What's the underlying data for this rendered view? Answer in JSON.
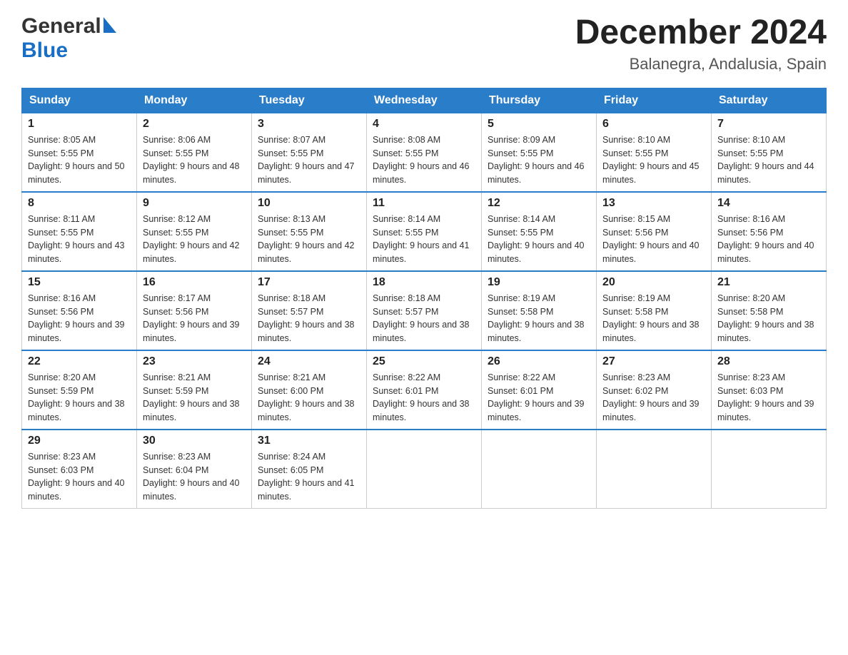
{
  "logo": {
    "general": "General",
    "blue": "Blue",
    "triangle": "▶"
  },
  "title": "December 2024",
  "subtitle": "Balanegra, Andalusia, Spain",
  "weekdays": [
    "Sunday",
    "Monday",
    "Tuesday",
    "Wednesday",
    "Thursday",
    "Friday",
    "Saturday"
  ],
  "weeks": [
    [
      {
        "day": "1",
        "sunrise": "8:05 AM",
        "sunset": "5:55 PM",
        "daylight": "9 hours and 50 minutes."
      },
      {
        "day": "2",
        "sunrise": "8:06 AM",
        "sunset": "5:55 PM",
        "daylight": "9 hours and 48 minutes."
      },
      {
        "day": "3",
        "sunrise": "8:07 AM",
        "sunset": "5:55 PM",
        "daylight": "9 hours and 47 minutes."
      },
      {
        "day": "4",
        "sunrise": "8:08 AM",
        "sunset": "5:55 PM",
        "daylight": "9 hours and 46 minutes."
      },
      {
        "day": "5",
        "sunrise": "8:09 AM",
        "sunset": "5:55 PM",
        "daylight": "9 hours and 46 minutes."
      },
      {
        "day": "6",
        "sunrise": "8:10 AM",
        "sunset": "5:55 PM",
        "daylight": "9 hours and 45 minutes."
      },
      {
        "day": "7",
        "sunrise": "8:10 AM",
        "sunset": "5:55 PM",
        "daylight": "9 hours and 44 minutes."
      }
    ],
    [
      {
        "day": "8",
        "sunrise": "8:11 AM",
        "sunset": "5:55 PM",
        "daylight": "9 hours and 43 minutes."
      },
      {
        "day": "9",
        "sunrise": "8:12 AM",
        "sunset": "5:55 PM",
        "daylight": "9 hours and 42 minutes."
      },
      {
        "day": "10",
        "sunrise": "8:13 AM",
        "sunset": "5:55 PM",
        "daylight": "9 hours and 42 minutes."
      },
      {
        "day": "11",
        "sunrise": "8:14 AM",
        "sunset": "5:55 PM",
        "daylight": "9 hours and 41 minutes."
      },
      {
        "day": "12",
        "sunrise": "8:14 AM",
        "sunset": "5:55 PM",
        "daylight": "9 hours and 40 minutes."
      },
      {
        "day": "13",
        "sunrise": "8:15 AM",
        "sunset": "5:56 PM",
        "daylight": "9 hours and 40 minutes."
      },
      {
        "day": "14",
        "sunrise": "8:16 AM",
        "sunset": "5:56 PM",
        "daylight": "9 hours and 40 minutes."
      }
    ],
    [
      {
        "day": "15",
        "sunrise": "8:16 AM",
        "sunset": "5:56 PM",
        "daylight": "9 hours and 39 minutes."
      },
      {
        "day": "16",
        "sunrise": "8:17 AM",
        "sunset": "5:56 PM",
        "daylight": "9 hours and 39 minutes."
      },
      {
        "day": "17",
        "sunrise": "8:18 AM",
        "sunset": "5:57 PM",
        "daylight": "9 hours and 38 minutes."
      },
      {
        "day": "18",
        "sunrise": "8:18 AM",
        "sunset": "5:57 PM",
        "daylight": "9 hours and 38 minutes."
      },
      {
        "day": "19",
        "sunrise": "8:19 AM",
        "sunset": "5:58 PM",
        "daylight": "9 hours and 38 minutes."
      },
      {
        "day": "20",
        "sunrise": "8:19 AM",
        "sunset": "5:58 PM",
        "daylight": "9 hours and 38 minutes."
      },
      {
        "day": "21",
        "sunrise": "8:20 AM",
        "sunset": "5:58 PM",
        "daylight": "9 hours and 38 minutes."
      }
    ],
    [
      {
        "day": "22",
        "sunrise": "8:20 AM",
        "sunset": "5:59 PM",
        "daylight": "9 hours and 38 minutes."
      },
      {
        "day": "23",
        "sunrise": "8:21 AM",
        "sunset": "5:59 PM",
        "daylight": "9 hours and 38 minutes."
      },
      {
        "day": "24",
        "sunrise": "8:21 AM",
        "sunset": "6:00 PM",
        "daylight": "9 hours and 38 minutes."
      },
      {
        "day": "25",
        "sunrise": "8:22 AM",
        "sunset": "6:01 PM",
        "daylight": "9 hours and 38 minutes."
      },
      {
        "day": "26",
        "sunrise": "8:22 AM",
        "sunset": "6:01 PM",
        "daylight": "9 hours and 39 minutes."
      },
      {
        "day": "27",
        "sunrise": "8:23 AM",
        "sunset": "6:02 PM",
        "daylight": "9 hours and 39 minutes."
      },
      {
        "day": "28",
        "sunrise": "8:23 AM",
        "sunset": "6:03 PM",
        "daylight": "9 hours and 39 minutes."
      }
    ],
    [
      {
        "day": "29",
        "sunrise": "8:23 AM",
        "sunset": "6:03 PM",
        "daylight": "9 hours and 40 minutes."
      },
      {
        "day": "30",
        "sunrise": "8:23 AM",
        "sunset": "6:04 PM",
        "daylight": "9 hours and 40 minutes."
      },
      {
        "day": "31",
        "sunrise": "8:24 AM",
        "sunset": "6:05 PM",
        "daylight": "9 hours and 41 minutes."
      },
      null,
      null,
      null,
      null
    ]
  ],
  "labels": {
    "sunrise": "Sunrise: ",
    "sunset": "Sunset: ",
    "daylight": "Daylight: "
  }
}
